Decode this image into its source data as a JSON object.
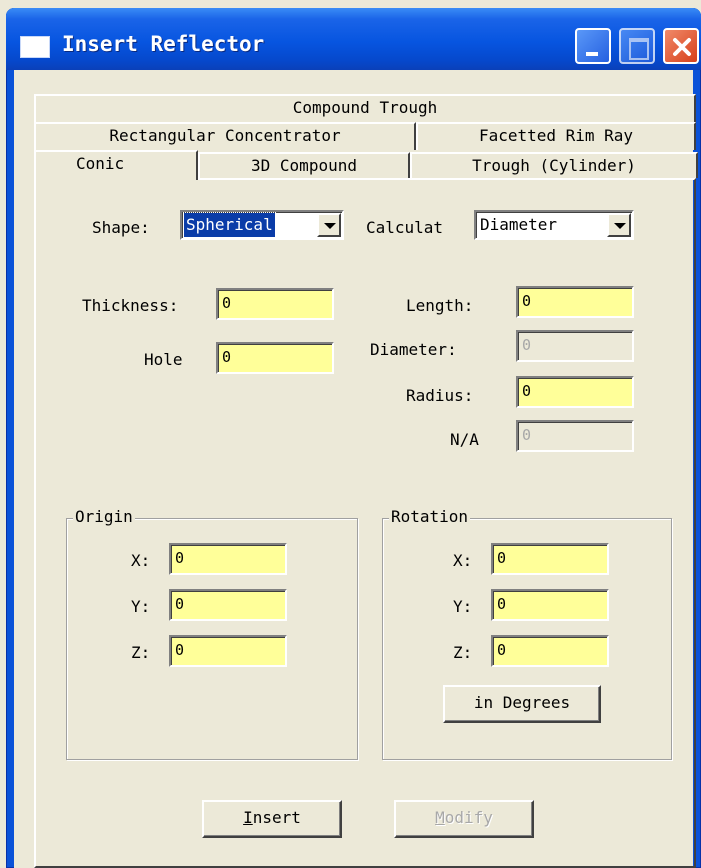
{
  "window": {
    "title": "Insert Reflector"
  },
  "tabs": {
    "row1": [
      "Compound Trough"
    ],
    "row2": [
      "Rectangular Concentrator",
      "Facetted Rim Ray"
    ],
    "row3": [
      "Conic",
      "3D Compound",
      "Trough (Cylinder)"
    ],
    "selected": "Conic"
  },
  "form": {
    "shape_label": "Shape:",
    "shape_value": "Spherical",
    "calculat_label": "Calculat",
    "calculat_value": "Diameter",
    "thickness_label": "Thickness:",
    "thickness_value": "0",
    "hole_label": "Hole",
    "hole_value": "0",
    "length_label": "Length:",
    "length_value": "0",
    "diameter_label": "Diameter:",
    "diameter_value": "0",
    "radius_label": "Radius:",
    "radius_value": "0",
    "na_label": "N/A",
    "na_value": "0"
  },
  "origin": {
    "title": "Origin",
    "x_label": "X:",
    "x_value": "0",
    "y_label": "Y:",
    "y_value": "0",
    "z_label": "Z:",
    "z_value": "0"
  },
  "rotation": {
    "title": "Rotation",
    "x_label": "X:",
    "x_value": "0",
    "y_label": "Y:",
    "y_value": "0",
    "z_label": "Z:",
    "z_value": "0",
    "units_button": "in Degrees"
  },
  "buttons": {
    "insert_first": "I",
    "insert_rest": "nsert",
    "modify_first": "M",
    "modify_rest": "odify"
  },
  "colors": {
    "input_bg": "#ffff99",
    "titlebar": "#0755e0",
    "face": "#ece9d8"
  }
}
